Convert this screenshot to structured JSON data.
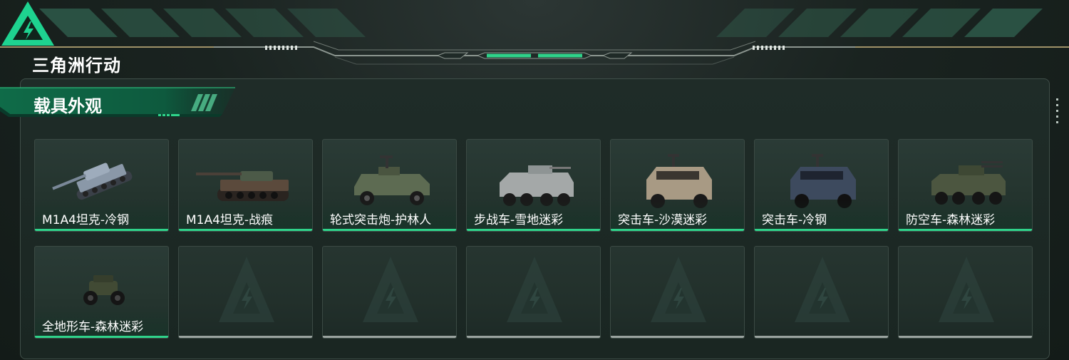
{
  "header": {
    "game_title": "三角洲行动"
  },
  "section": {
    "title": "载具外观"
  },
  "colors": {
    "accent": "#2fd38a",
    "panel_bg": "#1c2824",
    "empty_bar": "#9aa39f"
  },
  "vehicles": [
    {
      "label": "M1A4坦克-冷钢",
      "icon": "tank-icon",
      "color": "#8a98a8"
    },
    {
      "label": "M1A4坦克-战痕",
      "icon": "tank-icon",
      "color": "#5b4a3c"
    },
    {
      "label": "轮式突击炮-护林人",
      "icon": "armored-car-icon",
      "color": "#5d6b52"
    },
    {
      "label": "步战车-雪地迷彩",
      "icon": "ifv-icon",
      "color": "#a4a8a8"
    },
    {
      "label": "突击车-沙漠迷彩",
      "icon": "assault-vehicle-icon",
      "color": "#a89a84"
    },
    {
      "label": "突击车-冷钢",
      "icon": "assault-vehicle-icon",
      "color": "#3d4a5e"
    },
    {
      "label": "防空车-森林迷彩",
      "icon": "aa-vehicle-icon",
      "color": "#4c5640"
    },
    {
      "label": "全地形车-森林迷彩",
      "icon": "atv-icon",
      "color": "#414a34"
    }
  ],
  "empty_slots": 6
}
